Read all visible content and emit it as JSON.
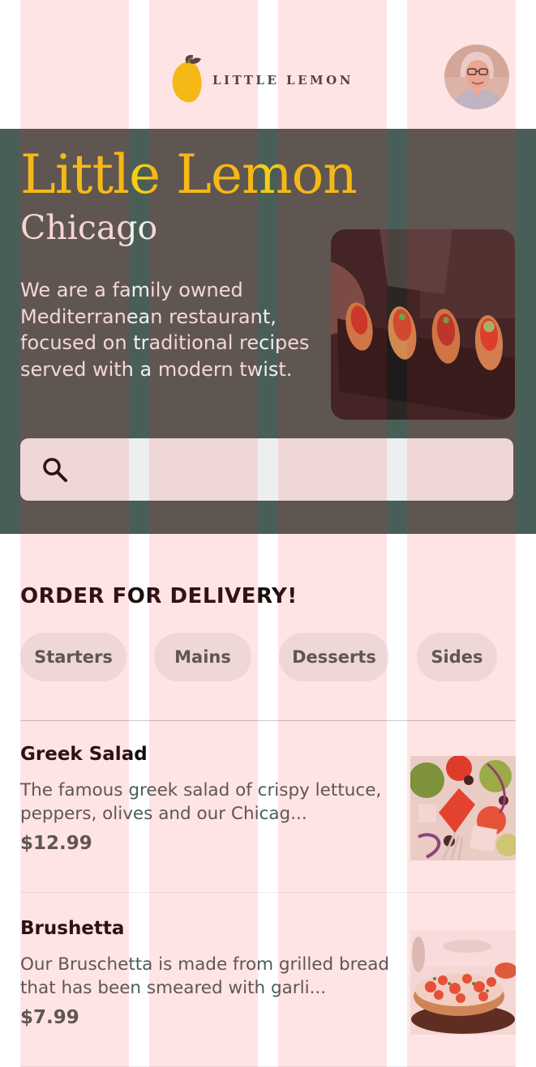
{
  "header": {
    "logo_text": "LITTLE LEMON",
    "logo_icon": "lemon-icon",
    "avatar_icon": "user-avatar"
  },
  "hero": {
    "title": "Little Lemon",
    "city": "Chicago",
    "description": "We are a family owned Mediterranean restaurant, focused on traditional recipes served with a modern twist.",
    "search_placeholder": "",
    "search_icon": "search-icon"
  },
  "order": {
    "title": "ORDER FOR DELIVERY!",
    "categories": [
      "Starters",
      "Mains",
      "Desserts",
      "Sides"
    ]
  },
  "menu": [
    {
      "name": "Greek Salad",
      "description": "The famous greek salad of crispy lettuce, peppers, olives and our Chicag...",
      "price": "$12.99"
    },
    {
      "name": "Brushetta",
      "description": "Our Bruschetta is made from grilled bread that has been smeared with garli...",
      "price": "$7.99"
    }
  ],
  "colors": {
    "primary_green": "#495e57",
    "primary_yellow": "#f4ce14",
    "highlight_light": "#edefee",
    "overlay": "rgba(255,30,50,0.12)"
  }
}
